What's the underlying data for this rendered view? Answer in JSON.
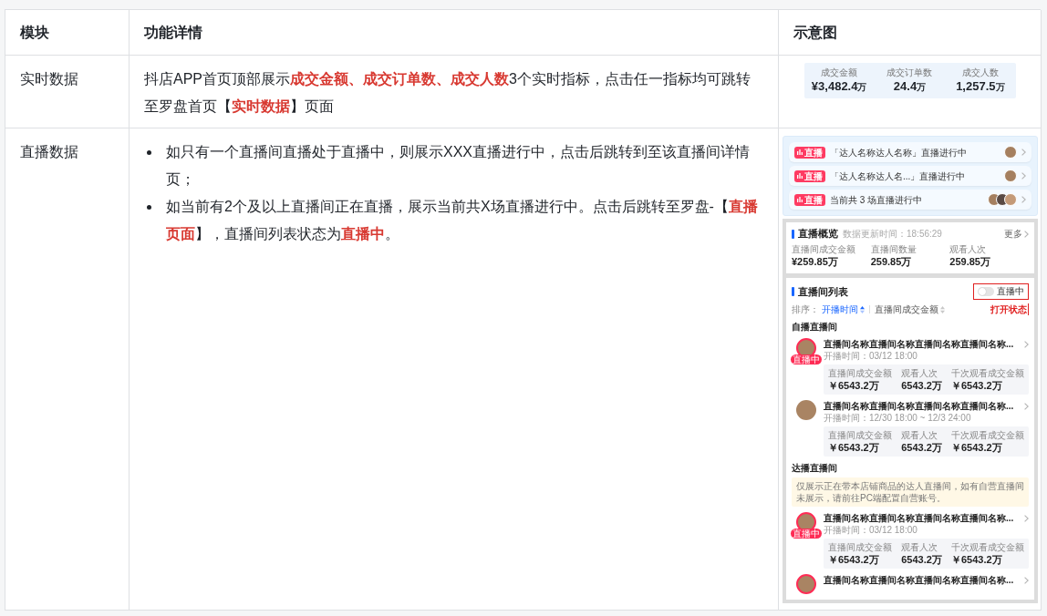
{
  "table": {
    "columns": [
      "模块",
      "功能详情",
      "示意图"
    ],
    "rows": [
      {
        "module": "实时数据",
        "details": {
          "kind": "paragraph",
          "text": "抖店APP首页顶部展示**成交金额、成交订单数、成交人数**3个实时指标，点击任一指标均可跳转至罗盘首页【**实时数据**】页面"
        },
        "preview": {
          "kind": "metrics",
          "metrics": [
            {
              "label": "成交金额",
              "value": "¥3,482.4",
              "unit": "万"
            },
            {
              "label": "成交订单数",
              "value": "24.4",
              "unit": "万"
            },
            {
              "label": "成交人数",
              "value": "1,257.5",
              "unit": "万"
            }
          ]
        }
      },
      {
        "module": "直播数据",
        "details": {
          "kind": "bullets",
          "items": [
            "如只有一个直播间直播处于直播中，则展示XXX直播进行中，点击后跳转到至该直播间详情页；",
            "如当前有2个及以上直播间正在直播，展示当前共X场直播进行中。点击后跳转至罗盘-【**直播页面**】，直播间列表状态为**直播中**。"
          ]
        },
        "preview": {
          "kind": "live_mockup",
          "banners": [
            {
              "badge": "直播",
              "text": "「达人名称达人名称」直播进行中",
              "kind": "single"
            },
            {
              "badge": "直播",
              "text": "「达人名称达人名...」直播进行中",
              "kind": "single"
            },
            {
              "badge": "直播",
              "text": "当前共 3 场直播进行中",
              "kind": "group"
            }
          ],
          "overview": {
            "title": "直播概览",
            "updated": "数据更新时间：18:56:29",
            "more": "更多",
            "stats": [
              {
                "label": "直播间成交金额",
                "value": "¥259.85万"
              },
              {
                "label": "直播间数量",
                "value": "259.85万"
              },
              {
                "label": "观看人次",
                "value": "259.85万"
              }
            ]
          },
          "list": {
            "title": "直播间列表",
            "toggle": {
              "label": "直播中",
              "on": false
            },
            "annotation": "打开状态",
            "sort_label": "排序：",
            "sorts": [
              {
                "label": "开播时间",
                "selected": true
              },
              {
                "label": "直播间成交金额",
                "selected": false
              }
            ],
            "sections": [
              {
                "title": "自播直播间",
                "rooms": [
                  {
                    "name": "直播间名称直播间名称直播间名称直播间名称...",
                    "live": true,
                    "badge": "直播中",
                    "time": "开播时间：03/12 18:00",
                    "stats": [
                      {
                        "label": "直播间成交金额",
                        "value": "￥6543.2万"
                      },
                      {
                        "label": "观看人次",
                        "value": "6543.2万"
                      },
                      {
                        "label": "千次观看成交金额",
                        "value": "￥6543.2万"
                      }
                    ]
                  },
                  {
                    "name": "直播间名称直播间名称直播间名称直播间名称...",
                    "live": false,
                    "time": "开播时间：12/30 18:00 ~ 12/3 24:00",
                    "stats": [
                      {
                        "label": "直播间成交金额",
                        "value": "￥6543.2万"
                      },
                      {
                        "label": "观看人次",
                        "value": "6543.2万"
                      },
                      {
                        "label": "千次观看成交金额",
                        "value": "￥6543.2万"
                      }
                    ]
                  }
                ]
              },
              {
                "title": "达播直播间",
                "notice": "仅展示正在带本店铺商品的达人直播间，如有自营直播间未展示，请前往PC端配置自营账号。",
                "rooms": [
                  {
                    "name": "直播间名称直播间名称直播间名称直播间名称...",
                    "live": true,
                    "badge": "直播中",
                    "time": "开播时间：03/12 18:00",
                    "stats": [
                      {
                        "label": "直播间成交金额",
                        "value": "￥6543.2万"
                      },
                      {
                        "label": "观看人次",
                        "value": "6543.2万"
                      },
                      {
                        "label": "千次观看成交金额",
                        "value": "￥6543.2万"
                      }
                    ]
                  },
                  {
                    "name": "直播间名称直播间名称直播间名称直播间名称...",
                    "live": true
                  }
                ]
              }
            ]
          }
        }
      }
    ]
  }
}
